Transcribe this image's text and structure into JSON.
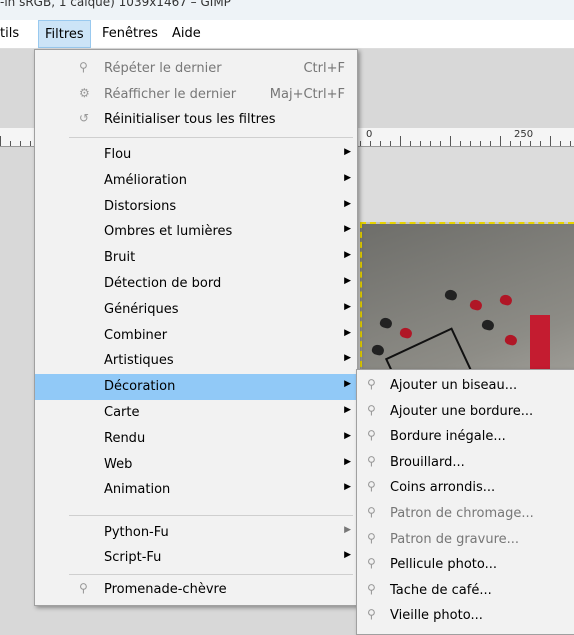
{
  "title": "-in sRGB, 1 calque) 1039x1467 – GIMP",
  "menubar": [
    {
      "label": "tils"
    },
    {
      "label": "Filtres"
    },
    {
      "label": "Fenêtres"
    },
    {
      "label": "Aide"
    }
  ],
  "ruler": {
    "label_0": "0",
    "label_250": "250"
  },
  "filters_menu": {
    "top_items": [
      {
        "label": "Répéter le dernier",
        "shortcut": "Ctrl+F",
        "icon": "repeat-icon"
      },
      {
        "label": "Réafficher le dernier",
        "shortcut": "Maj+Ctrl+F",
        "icon": "reshow-icon"
      },
      {
        "label": "Réinitialiser tous les filtres",
        "shortcut": "",
        "icon": "reset-icon"
      }
    ],
    "categories": [
      {
        "label": "Flou"
      },
      {
        "label": "Amélioration"
      },
      {
        "label": "Distorsions"
      },
      {
        "label": "Ombres et lumières"
      },
      {
        "label": "Bruit"
      },
      {
        "label": "Détection de bord"
      },
      {
        "label": "Génériques"
      },
      {
        "label": "Combiner"
      },
      {
        "label": "Artistiques"
      },
      {
        "label": "Décoration"
      },
      {
        "label": "Carte"
      },
      {
        "label": "Rendu"
      },
      {
        "label": "Web"
      },
      {
        "label": "Animation"
      }
    ],
    "script_items": [
      {
        "label": "Python-Fu"
      },
      {
        "label": "Script-Fu"
      }
    ],
    "bottom_item": {
      "label": "Promenade-chèvre",
      "icon": "goat-icon"
    }
  },
  "decoration_submenu": [
    {
      "label": "Ajouter un biseau..."
    },
    {
      "label": "Ajouter une bordure..."
    },
    {
      "label": "Bordure inégale..."
    },
    {
      "label": "Brouillard..."
    },
    {
      "label": "Coins arrondis..."
    },
    {
      "label": "Patron de chromage..."
    },
    {
      "label": "Patron de gravure..."
    },
    {
      "label": "Pellicule photo..."
    },
    {
      "label": "Tache de café..."
    },
    {
      "label": "Vieille photo..."
    }
  ],
  "colors": {
    "highlight": "#91c9f7",
    "menubar_active": "#cce4f7",
    "selection_dash": "#e8d400"
  }
}
